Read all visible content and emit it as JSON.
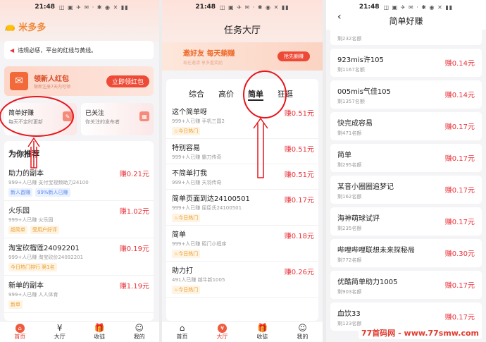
{
  "p1": {
    "time": "21:48",
    "icons": "◫ ▣ ✈ ✉ · ✱ ◉ ✕ ▮▮",
    "logo": "米多多",
    "notice": "违规必惩，平台的红线与黄线。",
    "redpacket": {
      "title": "领新人红包",
      "sub": "限新注册7天内可领",
      "button": "立即领红包"
    },
    "cards": [
      {
        "title": "简单好赚",
        "sub": "每天不定时更新"
      },
      {
        "title": "已关注",
        "sub": "你关注的发布者"
      }
    ],
    "rec_title": "为你推荐",
    "items": [
      {
        "name": "助力的副本",
        "sub": "999+人已赚    支付宝视频助力24100",
        "price": "赚0.21元",
        "tags": [
          "新人首赚",
          "99%新人已赚"
        ]
      },
      {
        "name": "火乐园",
        "sub": "999+人已赚    火乐园",
        "price": "赚1.02元",
        "tags": [
          "超简单",
          "受用户好评"
        ]
      },
      {
        "name": "淘宝砍榴莲24092201",
        "sub": "999+人已赚    淘宝砍价24092201",
        "price": "赚0.19元",
        "tags": [
          "今日热门排行 第1名"
        ]
      },
      {
        "name": "新单的副本",
        "sub": "999+人已赚    人人体育",
        "price": "赚1.19元",
        "tags": [
          "新单"
        ]
      }
    ],
    "nav": [
      "首页",
      "大厅",
      "收徒",
      "我的"
    ]
  },
  "p2": {
    "time": "21:48",
    "icons": "◫ ▣ ✈ ✉ · ✱ ◉ ✕ ▮▮",
    "title": "任务大厅",
    "banner": {
      "title": "邀好友 每天躺赚",
      "sub": "现在邀请 享多重奖励",
      "button": "抢先躺赚"
    },
    "tabs": [
      "综合",
      "高价",
      "简单",
      "狂逛"
    ],
    "items": [
      {
        "name": "这个简单呀",
        "sub": "999+人已赚    手机三国2",
        "price": "赚0.51元",
        "hot": "今日热门"
      },
      {
        "name": "特别容易",
        "sub": "999+人已赚    霸刀传奇",
        "price": "赚0.51元",
        "hot": ""
      },
      {
        "name": "不简单打我",
        "sub": "999+人已赚    天羽传奇",
        "price": "赚0.51元",
        "hot": ""
      },
      {
        "name": "简单页面到达24100501",
        "sub": "999+人已赚    屈臣氏24100501",
        "price": "赚0.17元",
        "hot": "今日热门"
      },
      {
        "name": "简单",
        "sub": "999+人已赚    昭门小程序",
        "price": "赚0.18元",
        "hot": "今日热门"
      },
      {
        "name": "助力打",
        "sub": "491人已赚    越牛新1005",
        "price": "赚0.26元",
        "hot": "今日热门"
      }
    ],
    "nav": [
      "首页",
      "大厅",
      "收徒",
      "我的"
    ]
  },
  "p3": {
    "time": "21:48",
    "icons": "◫ ▣ ✈ ✉ · ✱ ◉ ✕ ▮▮",
    "title": "简单好赚",
    "back": "‹",
    "items": [
      {
        "name": "",
        "sub": "剩232名额",
        "price": ""
      },
      {
        "name": "923mis许105",
        "sub": "剩1167名额",
        "price": "赚0.14元"
      },
      {
        "name": "005mis气佳105",
        "sub": "剩1357名额",
        "price": "赚0.14元"
      },
      {
        "name": "快完成容易",
        "sub": "剩471名额",
        "price": "赚0.17元"
      },
      {
        "name": "简单",
        "sub": "剩295名额",
        "price": "赚0.17元"
      },
      {
        "name": "某音小圈圈追梦记",
        "sub": "剩162名额",
        "price": "赚0.17元"
      },
      {
        "name": "海神萌球试评",
        "sub": "剩235名额",
        "price": "赚0.17元"
      },
      {
        "name": "哔哩哔哩联想未来探秘局",
        "sub": "剩772名额",
        "price": "赚0.30元"
      },
      {
        "name": "优酷简单助力1005",
        "sub": "剩903名额",
        "price": "赚0.17元"
      },
      {
        "name": "血饮33",
        "sub": "剩123名额",
        "price": "赚0.17元"
      }
    ]
  },
  "watermark": "77首码网 - www.77smw.com"
}
